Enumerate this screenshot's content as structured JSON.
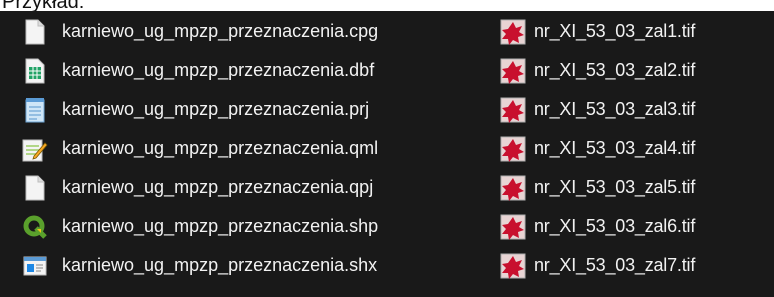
{
  "caption": "Przykład:",
  "files_left": [
    {
      "name": "karniewo_ug_mpzp_przeznaczenia.cpg",
      "icon": "blank-file-icon"
    },
    {
      "name": "karniewo_ug_mpzp_przeznaczenia.dbf",
      "icon": "spreadsheet-file-icon"
    },
    {
      "name": "karniewo_ug_mpzp_przeznaczenia.prj",
      "icon": "notepad-file-icon"
    },
    {
      "name": "karniewo_ug_mpzp_przeznaczenia.qml",
      "icon": "edit-document-file-icon"
    },
    {
      "name": "karniewo_ug_mpzp_przeznaczenia.qpj",
      "icon": "blank-file-icon"
    },
    {
      "name": "karniewo_ug_mpzp_przeznaczenia.shp",
      "icon": "qgis-file-icon"
    },
    {
      "name": "karniewo_ug_mpzp_przeznaczenia.shx",
      "icon": "binary-file-icon"
    }
  ],
  "files_right": [
    {
      "name": "nr_XI_53_03_zal1.tif",
      "icon": "tif-image-file-icon"
    },
    {
      "name": "nr_XI_53_03_zal2.tif",
      "icon": "tif-image-file-icon"
    },
    {
      "name": "nr_XI_53_03_zal3.tif",
      "icon": "tif-image-file-icon"
    },
    {
      "name": "nr_XI_53_03_zal4.tif",
      "icon": "tif-image-file-icon"
    },
    {
      "name": "nr_XI_53_03_zal5.tif",
      "icon": "tif-image-file-icon"
    },
    {
      "name": "nr_XI_53_03_zal6.tif",
      "icon": "tif-image-file-icon"
    },
    {
      "name": "nr_XI_53_03_zal7.tif",
      "icon": "tif-image-file-icon"
    }
  ],
  "colors": {
    "background": "#191919",
    "text": "#f2f2f2",
    "qgis_green": "#5aa02c",
    "tif_red": "#c8102e"
  }
}
